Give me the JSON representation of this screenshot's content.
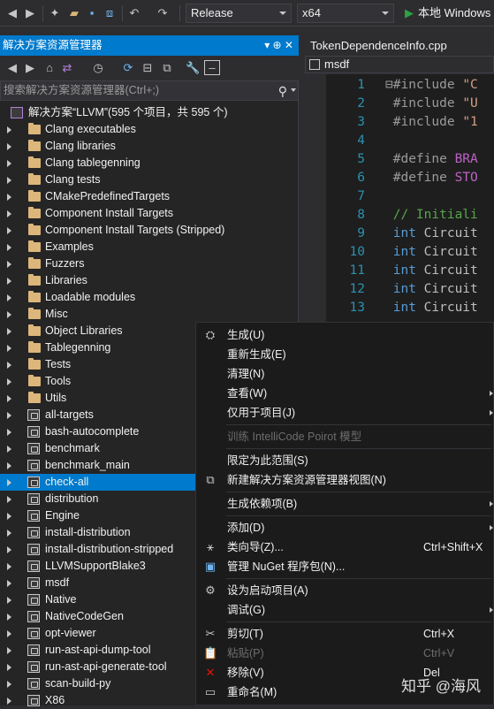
{
  "toolbar": {
    "config": "Release",
    "platform": "x64",
    "run_label": "本地 Windows"
  },
  "solution_explorer": {
    "title": "解决方案资源管理器",
    "title_icons": "▾ ⊕ ✕",
    "search_placeholder": "搜索解决方案资源管理器(Ctrl+;)",
    "root": "解决方案“LLVM”(595 个项目，共 595 个)",
    "folders": [
      "Clang executables",
      "Clang libraries",
      "Clang tablegenning",
      "Clang tests",
      "CMakePredefinedTargets",
      "Component Install Targets",
      "Component Install Targets (Stripped)",
      "Examples",
      "Fuzzers",
      "Libraries",
      "Loadable modules",
      "Misc",
      "Object Libraries",
      "Tablegenning",
      "Tests",
      "Tools",
      "Utils"
    ],
    "projects": [
      "all-targets",
      "bash-autocomplete",
      "benchmark",
      "benchmark_main",
      "check-all",
      "distribution",
      "Engine",
      "install-distribution",
      "install-distribution-stripped",
      "LLVMSupportBlake3",
      "msdf",
      "Native",
      "NativeCodeGen",
      "opt-viewer",
      "run-ast-api-dump-tool",
      "run-ast-api-generate-tool",
      "scan-build-py",
      "X86"
    ],
    "selected": "check-all"
  },
  "editor": {
    "tab": "TokenDependenceInfo.cpp",
    "scope": "msdf",
    "lines": [
      {
        "n": "1",
        "parts": [
          [
            "kw-pre",
            "⊟#include "
          ],
          [
            "kw-str",
            "\"C"
          ]
        ]
      },
      {
        "n": "2",
        "parts": [
          [
            "kw-pre",
            " #include "
          ],
          [
            "kw-str",
            "\"U"
          ]
        ]
      },
      {
        "n": "3",
        "parts": [
          [
            "kw-pre",
            " #include "
          ],
          [
            "kw-str",
            "\"1"
          ]
        ]
      },
      {
        "n": "4",
        "parts": []
      },
      {
        "n": "5",
        "parts": [
          [
            "kw-pre",
            " #define "
          ],
          [
            "kw-macro",
            "BRA"
          ]
        ]
      },
      {
        "n": "6",
        "parts": [
          [
            "kw-pre",
            " #define "
          ],
          [
            "kw-macro",
            "STO"
          ]
        ]
      },
      {
        "n": "7",
        "parts": []
      },
      {
        "n": "8",
        "parts": [
          [
            "kw-cmt",
            " // Initiali"
          ]
        ]
      },
      {
        "n": "9",
        "parts": [
          [
            "kw-int",
            " int "
          ],
          [
            "kw-id",
            "Circuit"
          ]
        ]
      },
      {
        "n": "10",
        "parts": [
          [
            "kw-int",
            " int "
          ],
          [
            "kw-id",
            "Circuit"
          ]
        ]
      },
      {
        "n": "11",
        "parts": [
          [
            "kw-int",
            " int "
          ],
          [
            "kw-id",
            "Circuit"
          ]
        ]
      },
      {
        "n": "12",
        "parts": [
          [
            "kw-int",
            " int "
          ],
          [
            "kw-id",
            "Circuit"
          ]
        ]
      },
      {
        "n": "13",
        "parts": [
          [
            "kw-int",
            " int "
          ],
          [
            "kw-id",
            "Circuit"
          ]
        ]
      }
    ]
  },
  "context_menu": {
    "items": [
      {
        "label": "生成(U)",
        "icon": "build-icon",
        "glyph": "⛭",
        "shortcut": "",
        "sub": false,
        "disabled": false
      },
      {
        "label": "重新生成(E)",
        "icon": "",
        "glyph": "",
        "shortcut": "",
        "sub": false,
        "disabled": false
      },
      {
        "label": "清理(N)",
        "icon": "",
        "glyph": "",
        "shortcut": "",
        "sub": false,
        "disabled": false
      },
      {
        "label": "查看(W)",
        "icon": "",
        "glyph": "",
        "shortcut": "",
        "sub": true,
        "disabled": false
      },
      {
        "label": "仅用于项目(J)",
        "icon": "",
        "glyph": "",
        "shortcut": "",
        "sub": true,
        "disabled": false
      },
      {
        "sep": true
      },
      {
        "label": "训练 IntelliCode Poirot 模型",
        "icon": "",
        "glyph": "",
        "shortcut": "",
        "sub": false,
        "disabled": true
      },
      {
        "sep": true
      },
      {
        "label": "限定为此范围(S)",
        "icon": "",
        "glyph": "",
        "shortcut": "",
        "sub": false,
        "disabled": false
      },
      {
        "label": "新建解决方案资源管理器视图(N)",
        "icon": "new-view-icon",
        "glyph": "⧉",
        "shortcut": "",
        "sub": false,
        "disabled": false
      },
      {
        "sep": true
      },
      {
        "label": "生成依赖项(B)",
        "icon": "",
        "glyph": "",
        "shortcut": "",
        "sub": true,
        "disabled": false
      },
      {
        "sep": true
      },
      {
        "label": "添加(D)",
        "icon": "",
        "glyph": "",
        "shortcut": "",
        "sub": true,
        "disabled": false
      },
      {
        "label": "类向导(Z)...",
        "icon": "class-wizard-icon",
        "glyph": "⚹",
        "shortcut": "Ctrl+Shift+X",
        "sub": false,
        "disabled": false
      },
      {
        "label": "管理 NuGet 程序包(N)...",
        "icon": "nuget-icon",
        "glyph": "▣",
        "shortcut": "",
        "sub": false,
        "disabled": false
      },
      {
        "sep": true
      },
      {
        "label": "设为启动项目(A)",
        "icon": "gear-icon",
        "glyph": "⚙",
        "shortcut": "",
        "sub": false,
        "disabled": false
      },
      {
        "label": "调试(G)",
        "icon": "",
        "glyph": "",
        "shortcut": "",
        "sub": true,
        "disabled": false
      },
      {
        "sep": true
      },
      {
        "label": "剪切(T)",
        "icon": "cut-icon",
        "glyph": "✂",
        "shortcut": "Ctrl+X",
        "sub": false,
        "disabled": false
      },
      {
        "label": "粘贴(P)",
        "icon": "paste-icon",
        "glyph": "📋",
        "shortcut": "Ctrl+V",
        "sub": false,
        "disabled": true
      },
      {
        "label": "移除(V)",
        "icon": "remove-icon",
        "glyph": "✕",
        "shortcut": "Del",
        "sub": false,
        "disabled": false
      },
      {
        "label": "重命名(M)",
        "icon": "rename-icon",
        "glyph": "▭",
        "shortcut": "",
        "sub": false,
        "disabled": false
      }
    ]
  },
  "watermark": "知乎 @海风"
}
